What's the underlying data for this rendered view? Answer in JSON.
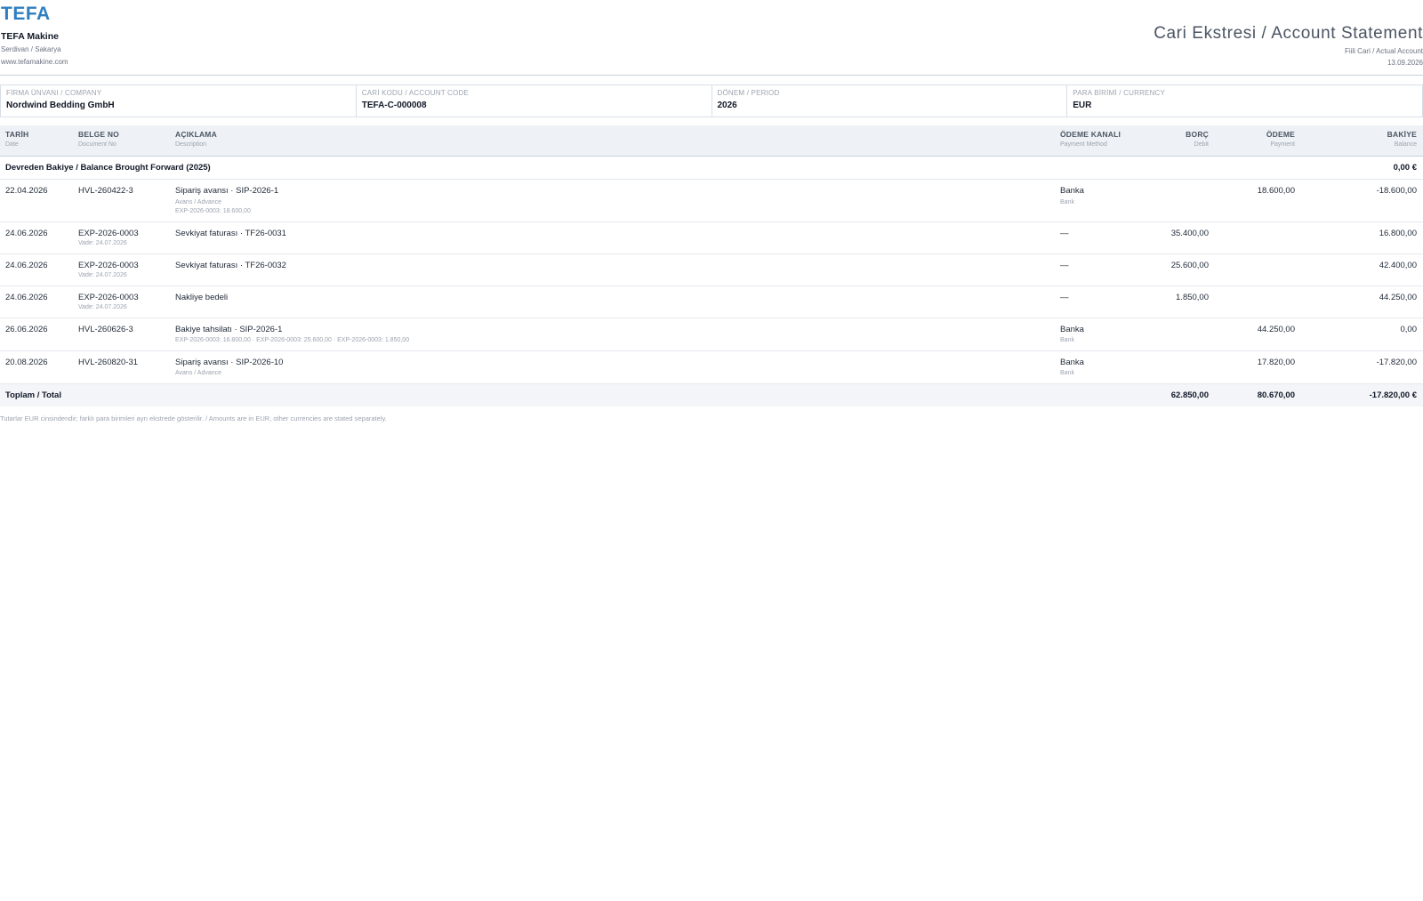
{
  "brand": {
    "logo": "TEFA",
    "name": "TEFA Makine",
    "city": "Serdivan / Sakarya",
    "website": "www.tefamakine.com"
  },
  "document": {
    "title": "Cari Ekstresi / Account Statement",
    "subtitle": "Fiili Cari / Actual Account",
    "date": "13.09.2026"
  },
  "info": {
    "company_label": "FİRMA ÜNVANI / COMPANY",
    "company_value": "Nordwind Bedding GmbH",
    "account_label": "CARİ KODU / ACCOUNT CODE",
    "account_value": "TEFA-C-000008",
    "period_label": "DÖNEM / PERIOD",
    "period_value": "2026",
    "currency_label": "PARA BİRİMİ / CURRENCY",
    "currency_value": "EUR"
  },
  "columns": {
    "date": {
      "main": "TARİH",
      "sub": "Date"
    },
    "doc": {
      "main": "BELGE NO",
      "sub": "Document No"
    },
    "desc": {
      "main": "AÇIKLAMA",
      "sub": "Description"
    },
    "method": {
      "main": "ÖDEME KANALI",
      "sub": "Payment Method"
    },
    "debit": {
      "main": "BORÇ",
      "sub": "Debit"
    },
    "payment": {
      "main": "ÖDEME",
      "sub": "Payment"
    },
    "balance": {
      "main": "BAKİYE",
      "sub": "Balance"
    }
  },
  "opening": {
    "label": "Devreden Bakiye / Balance Brought Forward (2025)",
    "balance": "0,00 €"
  },
  "rows": [
    {
      "date": "22.04.2026",
      "doc": "HVL-260422-3",
      "doc_note": "",
      "desc": "Sipariş avansı · SIP-2026-1",
      "desc_note1": "Avans / Advance",
      "desc_note2": "EXP-2026-0003: 18.600,00",
      "method": "Banka",
      "method_note": "Bank",
      "debit": "",
      "payment": "18.600,00",
      "balance": "-18.600,00"
    },
    {
      "date": "24.06.2026",
      "doc": "EXP-2026-0003",
      "doc_note": "Vade: 24.07.2026",
      "desc": "Sevkiyat faturası · TF26-0031",
      "desc_note1": "",
      "desc_note2": "",
      "method": "—",
      "method_note": "",
      "debit": "35.400,00",
      "payment": "",
      "balance": "16.800,00"
    },
    {
      "date": "24.06.2026",
      "doc": "EXP-2026-0003",
      "doc_note": "Vade: 24.07.2026",
      "desc": "Sevkiyat faturası · TF26-0032",
      "desc_note1": "",
      "desc_note2": "",
      "method": "—",
      "method_note": "",
      "debit": "25.600,00",
      "payment": "",
      "balance": "42.400,00"
    },
    {
      "date": "24.06.2026",
      "doc": "EXP-2026-0003",
      "doc_note": "Vade: 24.07.2026",
      "desc": "Nakliye bedeli",
      "desc_note1": "",
      "desc_note2": "",
      "method": "—",
      "method_note": "",
      "debit": "1.850,00",
      "payment": "",
      "balance": "44.250,00"
    },
    {
      "date": "26.06.2026",
      "doc": "HVL-260626-3",
      "doc_note": "",
      "desc": "Bakiye tahsilatı · SIP-2026-1",
      "desc_note1": "EXP-2026-0003: 16.800,00 · EXP-2026-0003: 25.600,00 · EXP-2026-0003: 1.850,00",
      "desc_note2": "",
      "method": "Banka",
      "method_note": "Bank",
      "debit": "",
      "payment": "44.250,00",
      "balance": "0,00"
    },
    {
      "date": "20.08.2026",
      "doc": "HVL-260820-31",
      "doc_note": "",
      "desc": "Sipariş avansı · SIP-2026-10",
      "desc_note1": "Avans / Advance",
      "desc_note2": "",
      "method": "Banka",
      "method_note": "Bank",
      "debit": "",
      "payment": "17.820,00",
      "balance": "-17.820,00"
    }
  ],
  "totals": {
    "label": "Toplam / Total",
    "debit": "62.850,00",
    "payment": "80.670,00",
    "balance": "-17.820,00 €"
  },
  "footnote": "Tutarlar EUR cinsindendir; farklı para birimleri ayrı ekstrede gösterilir. / Amounts are in EUR, other currencies are stated separately."
}
